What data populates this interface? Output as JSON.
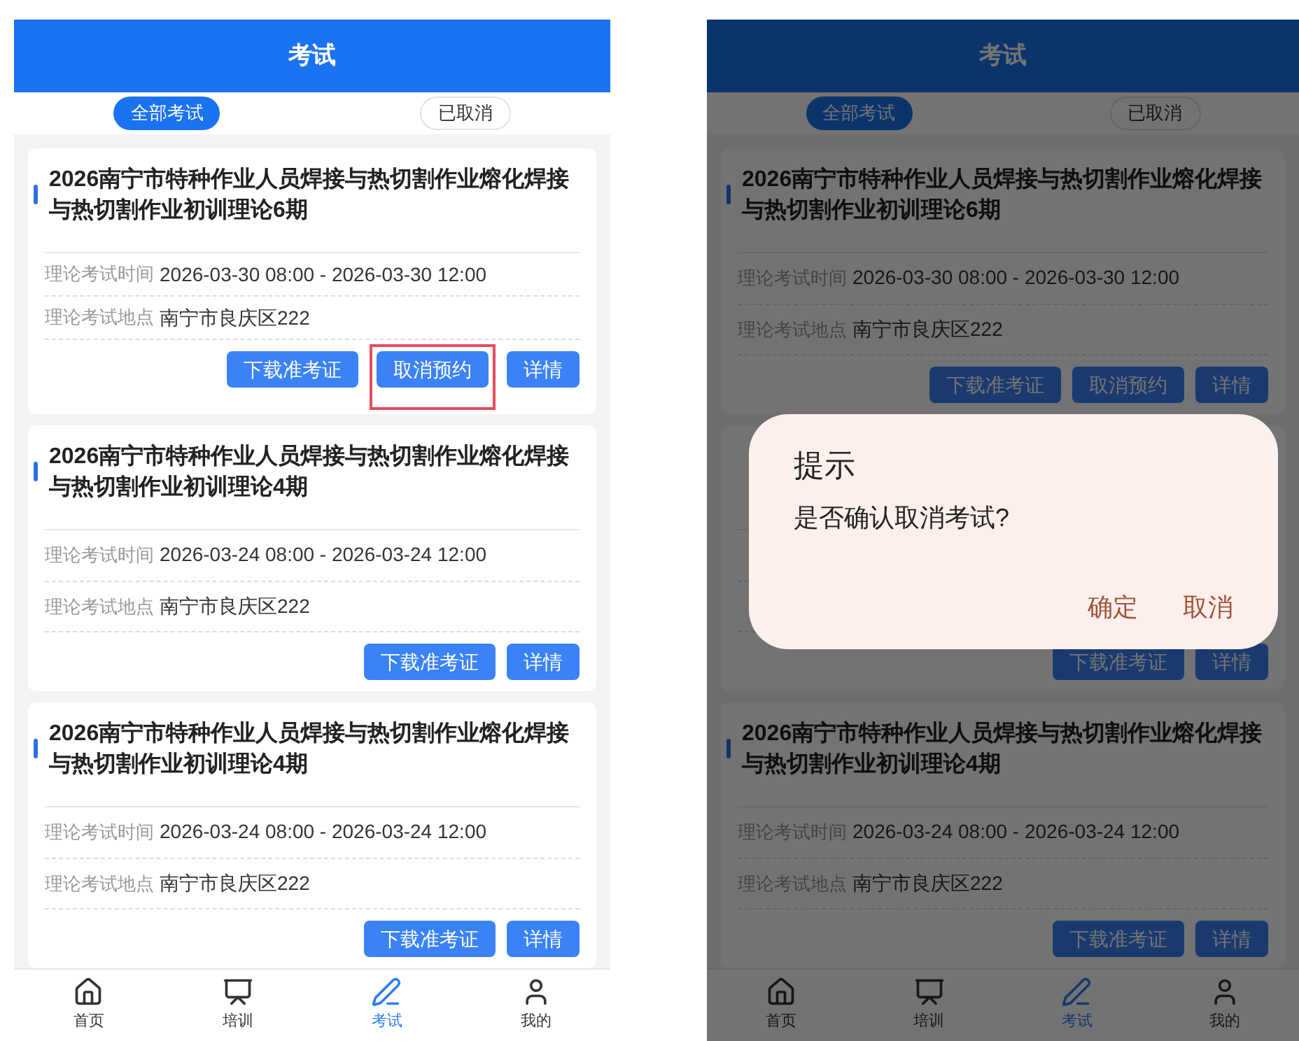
{
  "screens": [
    {
      "header": {
        "title": "考试"
      },
      "tabs": [
        {
          "label": "全部考试",
          "selected": true
        },
        {
          "label": "已取消",
          "selected": false
        }
      ],
      "cards": [
        {
          "title": "2026南宁市特种作业人员焊接与热切割作业熔化焊接与热切割作业初训理论6期",
          "time_label": "理论考试时间",
          "time": "2026-03-30 08:00 - 2026-03-30 12:00",
          "place_label": "理论考试地点",
          "place": "南宁市良庆区222",
          "actions": [
            {
              "label": "下载准考证",
              "highlighted": false
            },
            {
              "label": "取消预约",
              "highlighted": true
            },
            {
              "label": "详情",
              "highlighted": false
            }
          ]
        },
        {
          "title": "2026南宁市特种作业人员焊接与热切割作业熔化焊接与热切割作业初训理论4期",
          "time_label": "理论考试时间",
          "time": "2026-03-24 08:00 - 2026-03-24 12:00",
          "place_label": "理论考试地点",
          "place": "南宁市良庆区222",
          "actions": [
            {
              "label": "下载准考证",
              "highlighted": false
            },
            {
              "label": "详情",
              "highlighted": false
            }
          ]
        },
        {
          "title": "2026南宁市特种作业人员焊接与热切割作业熔化焊接与热切割作业初训理论4期",
          "time_label": "理论考试时间",
          "time": "2026-03-24 08:00 - 2026-03-24 12:00",
          "place_label": "理论考试地点",
          "place": "南宁市良庆区222",
          "actions": [
            {
              "label": "下载准考证",
              "highlighted": false
            },
            {
              "label": "详情",
              "highlighted": false
            }
          ]
        }
      ],
      "nav": [
        {
          "kind": "home",
          "label": "首页",
          "selected": false
        },
        {
          "kind": "training",
          "label": "培训",
          "selected": false
        },
        {
          "kind": "exam",
          "label": "考试",
          "selected": true
        },
        {
          "kind": "profile",
          "label": "我的",
          "selected": false
        }
      ]
    },
    {
      "header": {
        "title": "考试"
      },
      "tabs": [
        {
          "label": "全部考试",
          "selected": true
        },
        {
          "label": "已取消",
          "selected": false
        }
      ],
      "cards": [
        {
          "title": "2026南宁市特种作业人员焊接与热切割作业熔化焊接与热切割作业初训理论6期",
          "time_label": "理论考试时间",
          "time": "2026-03-30 08:00 - 2026-03-30 12:00",
          "place_label": "理论考试地点",
          "place": "南宁市良庆区222",
          "actions": [
            {
              "label": "下载准考证",
              "highlighted": false
            },
            {
              "label": "取消预约",
              "highlighted": false
            },
            {
              "label": "详情",
              "highlighted": false
            }
          ]
        },
        {
          "actions": [
            {
              "label": "下载准考证",
              "highlighted": false
            },
            {
              "label": "详情",
              "highlighted": false
            }
          ]
        },
        {
          "title": "2026南宁市特种作业人员焊接与热切割作业熔化焊接与热切割作业初训理论4期",
          "time_label": "理论考试时间",
          "time": "2026-03-24 08:00 - 2026-03-24 12:00",
          "place_label": "理论考试地点",
          "place": "南宁市良庆区222",
          "actions": [
            {
              "label": "下载准考证",
              "highlighted": false
            },
            {
              "label": "详情",
              "highlighted": false
            }
          ]
        }
      ],
      "nav": [
        {
          "kind": "home",
          "label": "首页",
          "selected": false
        },
        {
          "kind": "training",
          "label": "培训",
          "selected": false
        },
        {
          "kind": "exam",
          "label": "考试",
          "selected": true
        },
        {
          "kind": "profile",
          "label": "我的",
          "selected": false
        }
      ],
      "dialog": {
        "title": "提示",
        "message": "是否确认取消考试?",
        "buttons": [
          "确定",
          "取消"
        ]
      }
    }
  ]
}
